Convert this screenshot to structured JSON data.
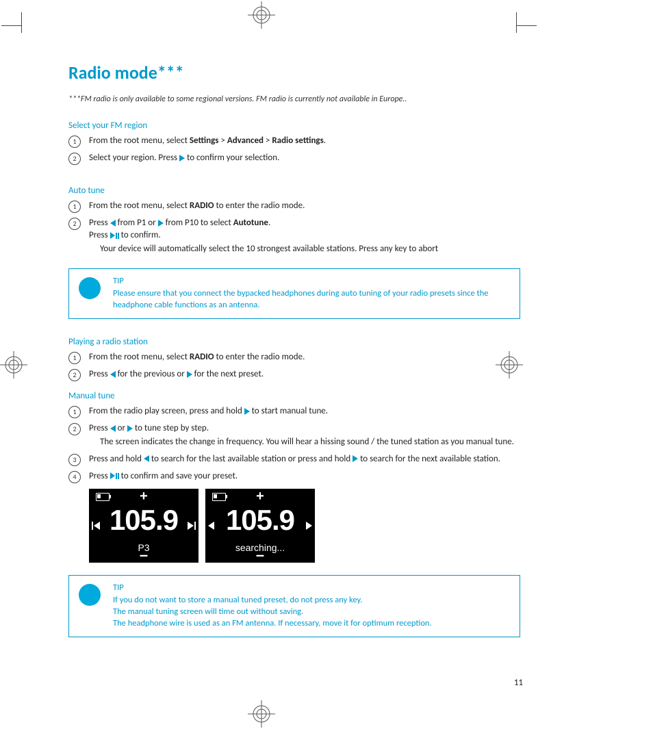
{
  "page_number": "11",
  "title": "Radio mode***",
  "footnote": "***FM radio is only available to some regional versions. FM  radio is currently not available in Europe..",
  "sections": {
    "fm_region": {
      "heading": "Select your FM region",
      "steps": [
        {
          "n": "1",
          "pre": "From the root menu, select ",
          "b1": "Settings",
          "mid1": " > ",
          "b2": "Advanced",
          "mid2": " > ",
          "b3": "Radio settings",
          "post": "."
        },
        {
          "n": "2",
          "pre": "Select your region.  Press ",
          "post": " to confirm your selection."
        }
      ]
    },
    "auto_tune": {
      "heading": "Auto tune",
      "steps": [
        {
          "n": "1",
          "pre": "From the root menu, select ",
          "b1": "RADIO",
          "post": " to enter the radio mode."
        },
        {
          "n": "2",
          "pre": "Press ",
          "mid1": " from P1 or ",
          "mid2": " from P10 to select ",
          "b1": "Autotune",
          "post": ".",
          "line2_pre": "Press ",
          "line2_post": " to confirm.",
          "sub": "Your device will automatically select the 10 strongest available stations.  Press any key to abort"
        }
      ]
    },
    "playing": {
      "heading": "Playing a radio station",
      "steps": [
        {
          "n": "1",
          "pre": "From the root menu, select ",
          "b1": "RADIO",
          "post": " to enter the radio mode."
        },
        {
          "n": "2",
          "pre": "Press ",
          "mid1": " for the previous or ",
          "post": " for the next preset."
        }
      ]
    },
    "manual": {
      "heading": "Manual tune",
      "steps": [
        {
          "n": "1",
          "pre": "From the radio play screen, press and hold ",
          "post": " to start manual tune."
        },
        {
          "n": "2",
          "pre": "Press ",
          "mid1": "  or ",
          "post": " to tune step by step.",
          "sub": "The screen indicates the change in frequency.  You will hear a hissing sound / the tuned station as you manual tune."
        },
        {
          "n": "3",
          "pre": "Press and hold ",
          "mid1": " to search for the last available station or press and hold ",
          "post": " to search for the next available station."
        },
        {
          "n": "4",
          "pre": "Press ",
          "post": " to confirm and save your preset."
        }
      ]
    }
  },
  "tips": {
    "t1": {
      "title": "TIP",
      "body": "Please ensure that you connect the bypacked headphones during auto tuning of your radio presets since the headphone cable functions as an antenna."
    },
    "t2": {
      "title": "TIP",
      "l1": "If you do not want to store a manual tuned preset, do not press any key.",
      "l2": "The manual tuning screen will time out without saving.",
      "l3": "The headphone wire is used as an FM antenna. If necessary, move it for optimum reception."
    }
  },
  "screens": {
    "s1": {
      "freq": "105.9",
      "label": "P3",
      "plus": "+",
      "minus": "–"
    },
    "s2": {
      "freq": "105.9",
      "label": "searching...",
      "plus": "+",
      "minus": "–"
    }
  }
}
